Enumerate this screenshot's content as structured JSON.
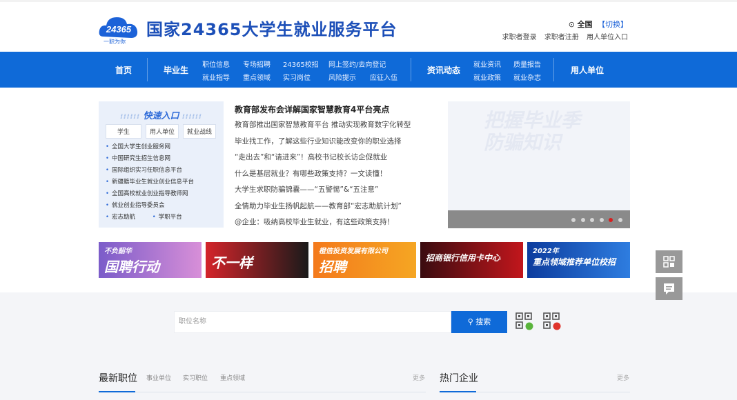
{
  "header": {
    "logo_num": "24365",
    "logo_sub": "一职为你",
    "title": "国家24365大学生就业服务平台",
    "region": "全国",
    "switch": "【切换】",
    "links": [
      "求职者登录",
      "求职者注册",
      "用人单位入口"
    ]
  },
  "nav": {
    "home": "首页",
    "graduate": "毕业生",
    "sub1": [
      "职位信息",
      "专场招聘",
      "24365校招",
      "网上签约/去向登记"
    ],
    "sub2": [
      "就业指导",
      "重点领域",
      "实习岗位",
      "风险提示",
      "应征入伍"
    ],
    "news": "资讯动态",
    "sub3": [
      "就业资讯",
      "质量报告"
    ],
    "sub4": [
      "就业政策",
      "就业杂志"
    ],
    "employer": "用人单位"
  },
  "quick": {
    "title": "快速入口",
    "tabs": [
      "学生",
      "用人单位",
      "就业战线"
    ],
    "links": [
      "全国大学生创业服务网",
      "中国研究生招生信息网",
      "国际组织实习任职信息平台",
      "新疆籍毕业生就业创业信息平台",
      "全国高校就业创业指导教师网",
      "就业创业指导委员会"
    ],
    "last_row": [
      "宏志助航",
      "学职平台"
    ]
  },
  "news": {
    "headline": "教育部发布会详解国家智慧教育4平台亮点",
    "items": [
      "教育部推出国家智慧教育平台 推动实现教育数字化转型",
      "毕业找工作，了解这些行业知识能改变你的职业选择",
      "“走出去”和“请进来”！高校书记校长访企促就业",
      "什么是基层就业？有哪些政策支持？一文读懂！",
      "大学生求职防骗锦囊——“五警惕”&“五注意”",
      "全情助力毕业生扬帆起航——教育部“宏志助航计划”",
      "@企业：吸纳高校毕业生就业，有这些政策支持！"
    ]
  },
  "slide": {
    "faint1": "把握毕业季",
    "faint2": "防骗知识",
    "dots": 6,
    "active": 4
  },
  "banners": [
    {
      "text": "国聘行动",
      "top": "不负韶华",
      "color1": "#7b5cc9",
      "color2": "#d88fd8"
    },
    {
      "text": "不一样",
      "top": "",
      "color1": "#d4242a",
      "color2": "#1a1a1a"
    },
    {
      "text": "招聘",
      "top": "橙信投资发展有限公司",
      "color1": "#f47a1c",
      "color2": "#f5a623"
    },
    {
      "text": "招商银行信用卡中心",
      "top": "",
      "color1": "#3a0c10",
      "color2": "#c2161c"
    },
    {
      "text": "重点领域推荐单位校招",
      "top": "2022年",
      "color1": "#0d3c9e",
      "color2": "#2e7de0"
    }
  ],
  "search": {
    "placeholder": "职位名称",
    "button": "搜索"
  },
  "sections": {
    "latest": "最新职位",
    "tabs": [
      "事业单位",
      "实习职位",
      "重点领域"
    ],
    "more": "更多",
    "hot": "热门企业"
  }
}
